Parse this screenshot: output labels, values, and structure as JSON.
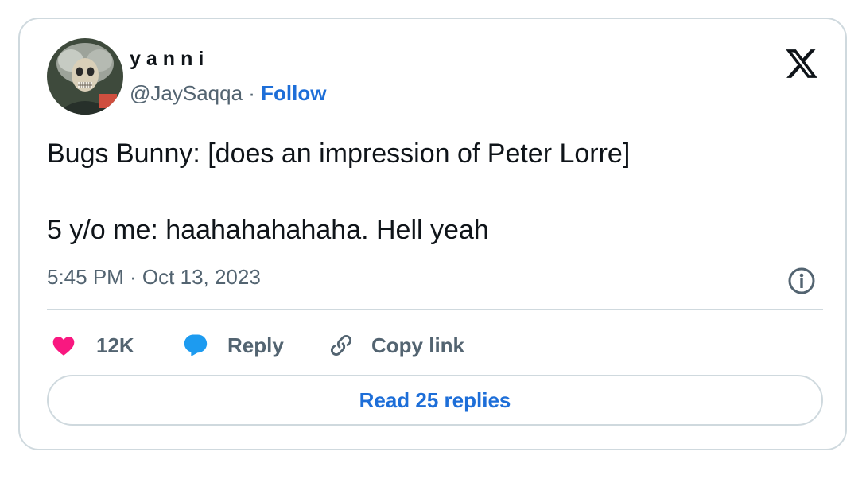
{
  "author": {
    "display_name": "yanni",
    "handle": "@JaySaqqa",
    "separator": " · ",
    "follow_label": "Follow"
  },
  "tweet": {
    "text": "Bugs Bunny: [does an impression of Peter Lorre]\n\n5 y/o me: haahahahahaha. Hell yeah",
    "timestamp": "5:45 PM · Oct 13, 2023"
  },
  "actions": {
    "like_count": "12K",
    "reply_label": "Reply",
    "copy_link_label": "Copy link"
  },
  "read_replies_label": "Read 25 replies",
  "colors": {
    "link": "#1d6ed8",
    "like": "#f91880",
    "reply": "#1d9bf0",
    "muted": "#536471",
    "border": "#cfd9de"
  },
  "icons": {
    "brand": "x-logo-icon",
    "info": "info-icon",
    "like": "heart-icon",
    "reply": "speech-bubble-icon",
    "copy": "link-icon"
  }
}
